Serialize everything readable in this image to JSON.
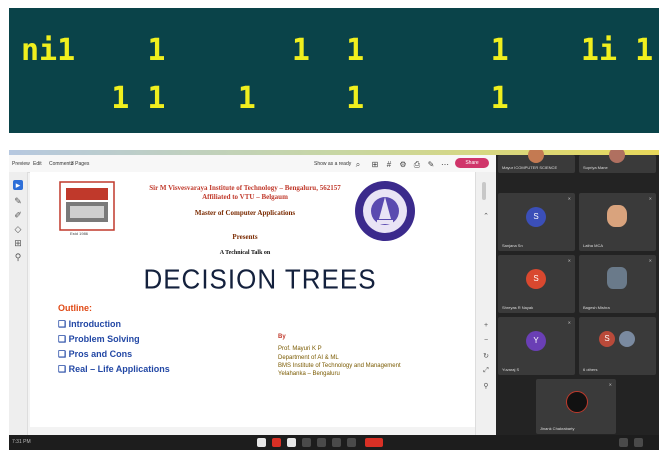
{
  "banner": {
    "line1": "ni1    1       1  1       1    1i 1",
    "line2": "     1 1    1     1       1",
    "bg_color": "#0a4349",
    "text_color": "#f0ef1e"
  },
  "viewer": {
    "toolbar": {
      "labels": [
        "Preview",
        "Edit",
        "Comments",
        "3 Pages"
      ],
      "zoom_text": "Show as a ready",
      "share_label": "Share"
    },
    "slide": {
      "institute_line1": "Sir M Visvesvaraya Institute of Technology – Bengaluru, 562157",
      "institute_line2": "Affiliated to VTU – Belgaum",
      "department": "Master of Computer Applications",
      "presents": "Presents",
      "talk_on": "A Technical Talk on",
      "title": "DECISION TREES",
      "estd": "Estd 1986",
      "outline_heading": "Outline:",
      "outline_items": [
        "❑ Introduction",
        "❑ Problem Solving",
        "❑ Pros and Cons",
        "❑ Real – Life Applications"
      ],
      "by": "By",
      "presenter": [
        "Prof. Mayuri K P",
        "Department of AI & ML",
        "BMS Institute of Technology and Management",
        "Yelahanka – Bengaluru"
      ]
    }
  },
  "gallery": {
    "participants": [
      {
        "name": "Mayur ICOMPUTER SCIENCE",
        "initial": "",
        "color": "#c47a52"
      },
      {
        "name": "Supriya Mane",
        "initial": "",
        "color": "#b07060"
      },
      {
        "name": "Sanjana Sn",
        "initial": "S",
        "color": "#3b4fb8"
      },
      {
        "name": "Latha MCA",
        "initial": "",
        "color": "#d9a37d"
      },
      {
        "name": "Shreyas R Nayak",
        "initial": "S",
        "color": "#d9482f"
      },
      {
        "name": "Bagesh Mishra",
        "initial": "",
        "color": "#6a7a8a"
      },
      {
        "name": "Yuvaraj S",
        "initial": "Y",
        "color": "#6a3fb5"
      },
      {
        "name": "6 others",
        "initial": "S",
        "color": "#b94a3a"
      },
      {
        "name": "Jinank Chakrabarty",
        "initial": "",
        "color": "#111111"
      }
    ]
  },
  "taskbar": {
    "time": "7:31 PM"
  }
}
